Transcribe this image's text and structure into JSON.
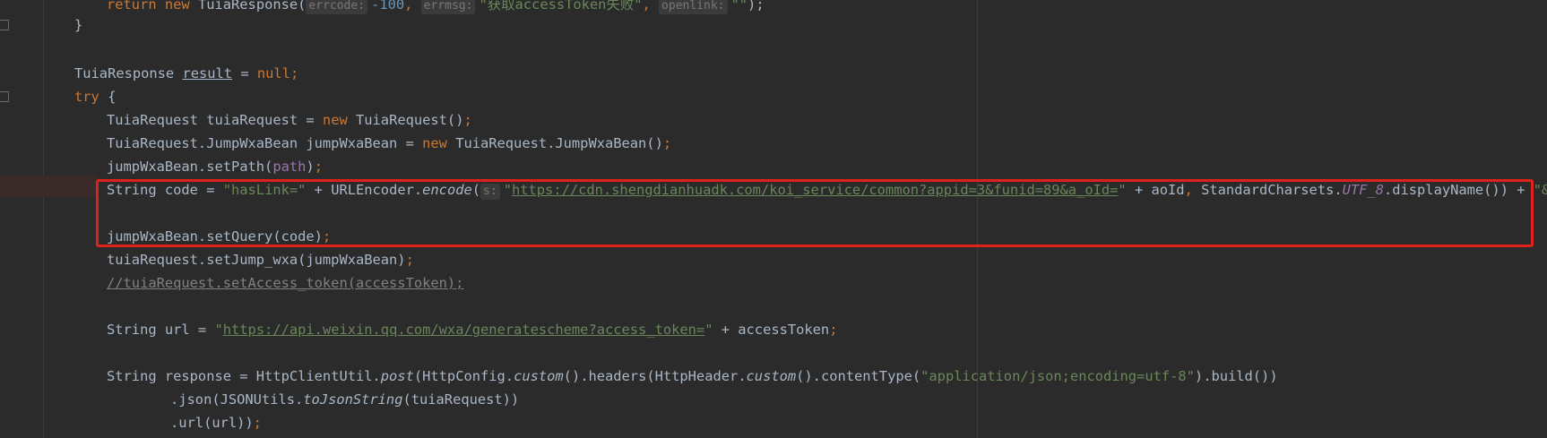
{
  "editor": {
    "lines": [
      {
        "id": "l1",
        "parts": [
          {
            "t": "return new TuiaResponse(",
            "c": "mix_return"
          },
          {
            "t": "errcode:",
            "c": "hint"
          },
          {
            "t": "-100",
            "c": "num"
          },
          {
            "t": ", ",
            "c": "kw"
          },
          {
            "t": "errmsg:",
            "c": "hint"
          },
          {
            "t": "\"获取accessToken失败\"",
            "c": "str"
          },
          {
            "t": ", ",
            "c": "kw"
          },
          {
            "t": "openlink:",
            "c": "hint"
          },
          {
            "t": "\"\"",
            "c": "str"
          },
          {
            "t": ");",
            "c": ""
          }
        ]
      },
      {
        "id": "l2",
        "parts": [
          {
            "t": "}",
            "c": ""
          }
        ]
      },
      {
        "id": "l3",
        "parts": []
      },
      {
        "id": "l4",
        "parts": [
          {
            "t": "TuiaResponse ",
            "c": ""
          },
          {
            "t": "result",
            "c": "underline"
          },
          {
            "t": " = ",
            "c": ""
          },
          {
            "t": "null",
            "c": "kw"
          },
          {
            "t": ";",
            "c": "kw"
          }
        ]
      },
      {
        "id": "l5",
        "parts": [
          {
            "t": "try",
            "c": "kw"
          },
          {
            "t": " {",
            "c": ""
          }
        ]
      },
      {
        "id": "l6",
        "parts": [
          {
            "t": "TuiaRequest tuiaRequest = ",
            "c": ""
          },
          {
            "t": "new",
            "c": "kw"
          },
          {
            "t": " TuiaRequest()",
            "c": ""
          },
          {
            "t": ";",
            "c": "kw"
          }
        ]
      },
      {
        "id": "l7",
        "parts": [
          {
            "t": "TuiaRequest.JumpWxaBean jumpWxaBean = ",
            "c": ""
          },
          {
            "t": "new",
            "c": "kw"
          },
          {
            "t": " TuiaRequest.JumpWxaBean()",
            "c": ""
          },
          {
            "t": ";",
            "c": "kw"
          }
        ]
      },
      {
        "id": "l8",
        "parts": [
          {
            "t": "jumpWxaBean.setPath(",
            "c": ""
          },
          {
            "t": "path",
            "c": "field"
          },
          {
            "t": ")",
            "c": ""
          },
          {
            "t": ";",
            "c": "kw"
          }
        ]
      },
      {
        "id": "l9",
        "parts": [
          {
            "t": "String code = ",
            "c": ""
          },
          {
            "t": "\"hasLink=\"",
            "c": "str"
          },
          {
            "t": " + URLEncoder.",
            "c": ""
          },
          {
            "t": "encode",
            "c": "ital"
          },
          {
            "t": "(",
            "c": ""
          },
          {
            "t": "s:",
            "c": "hint"
          },
          {
            "t": "\"",
            "c": "str"
          },
          {
            "t": "https://cdn.shengdianhuadk.com/koi_service/common?appid=3&funid=89&a_oId=",
            "c": "link"
          },
          {
            "t": "\"",
            "c": "str"
          },
          {
            "t": " + aoId",
            "c": ""
          },
          {
            "t": ", ",
            "c": "kw"
          },
          {
            "t": "StandardCharsets.",
            "c": ""
          },
          {
            "t": "UTF_8",
            "c": "static-field"
          },
          {
            "t": ".displayName()) + ",
            "c": ""
          },
          {
            "t": "\"&\"",
            "c": "str"
          },
          {
            "t": ";",
            "c": "kw"
          }
        ]
      },
      {
        "id": "l10",
        "parts": []
      },
      {
        "id": "l11",
        "parts": [
          {
            "t": "jumpWxaBean.setQuery(code)",
            "c": ""
          },
          {
            "t": ";",
            "c": "kw"
          }
        ]
      },
      {
        "id": "l12",
        "parts": [
          {
            "t": "tuiaRequest.setJump_wxa(jumpWxaBean)",
            "c": ""
          },
          {
            "t": ";",
            "c": "kw"
          }
        ]
      },
      {
        "id": "l13",
        "parts": [
          {
            "t": "//tuiaRequest.setAccess_token(accessToken);",
            "c": "comment"
          }
        ]
      },
      {
        "id": "l14",
        "parts": []
      },
      {
        "id": "l15",
        "parts": [
          {
            "t": "String url = ",
            "c": ""
          },
          {
            "t": "\"",
            "c": "str"
          },
          {
            "t": "https://api.weixin.qq.com/wxa/generatescheme?access_token=",
            "c": "link"
          },
          {
            "t": "\"",
            "c": "str"
          },
          {
            "t": " + accessToken",
            "c": ""
          },
          {
            "t": ";",
            "c": "kw"
          }
        ]
      },
      {
        "id": "l16",
        "parts": []
      },
      {
        "id": "l17",
        "parts": [
          {
            "t": "String response = HttpClientUtil.",
            "c": ""
          },
          {
            "t": "post",
            "c": "ital"
          },
          {
            "t": "(HttpConfig.",
            "c": ""
          },
          {
            "t": "custom",
            "c": "ital"
          },
          {
            "t": "().headers(HttpHeader.",
            "c": ""
          },
          {
            "t": "custom",
            "c": "ital"
          },
          {
            "t": "().contentType(",
            "c": ""
          },
          {
            "t": "\"application/json;encoding=utf-8\"",
            "c": "str"
          },
          {
            "t": ").build())",
            "c": ""
          }
        ]
      },
      {
        "id": "l18",
        "parts": [
          {
            "t": ".json(JSONUtils.",
            "c": ""
          },
          {
            "t": "toJsonString",
            "c": "ital"
          },
          {
            "t": "(tuiaRequest))",
            "c": ""
          }
        ]
      },
      {
        "id": "l19",
        "parts": [
          {
            "t": ".url(url))",
            "c": ""
          },
          {
            "t": ";",
            "c": "kw"
          }
        ]
      }
    ]
  }
}
